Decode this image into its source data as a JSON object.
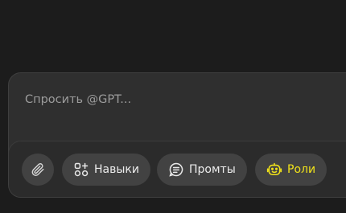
{
  "composer": {
    "placeholder": "Спросить @GPT..."
  },
  "toolbar": {
    "attach_icon": "paperclip-icon",
    "skills_label": "Навыки",
    "skills_icon": "grid-plus-icon",
    "prompts_label": "Промты",
    "prompts_icon": "list-bubble-icon",
    "roles_label": "Роли",
    "roles_icon": "robot-face-icon",
    "roles_color": "#f0e21a"
  }
}
